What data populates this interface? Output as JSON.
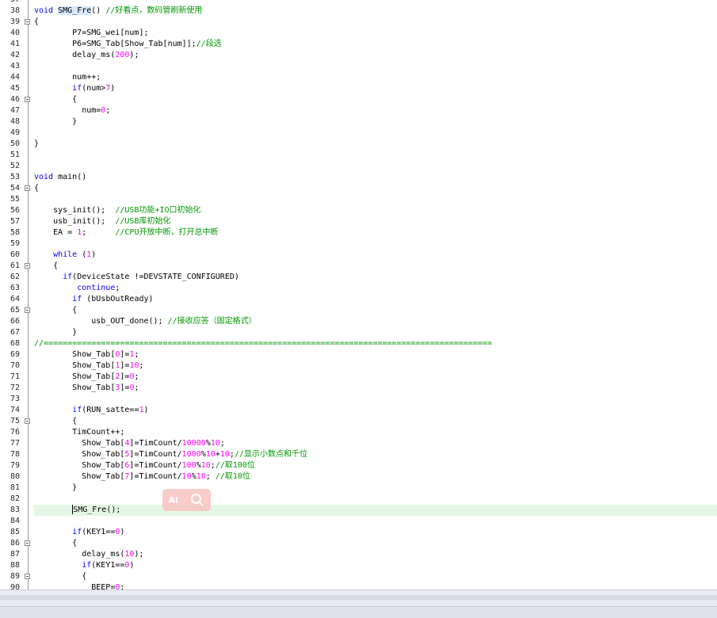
{
  "editor": {
    "lines": [
      {
        "n": "37",
        "fold": false,
        "html": ""
      },
      {
        "n": "38",
        "fold": false,
        "html": "<span class=\"kw\">void</span> <span class=\"hl\">SMG_Fre</span>() <span class=\"cm\">//好看点，数码管刷新使用</span>"
      },
      {
        "n": "39",
        "fold": true,
        "html": "{"
      },
      {
        "n": "40",
        "fold": false,
        "html": "        P7=SMG_wei[num];"
      },
      {
        "n": "41",
        "fold": false,
        "html": "        P6=SMG_Tab[Show_Tab[num]];<span class=\"cm\">//段选</span>"
      },
      {
        "n": "42",
        "fold": false,
        "html": "        delay_ms(<span class=\"num\">200</span>);"
      },
      {
        "n": "43",
        "fold": false,
        "html": ""
      },
      {
        "n": "44",
        "fold": false,
        "html": "        num++;"
      },
      {
        "n": "45",
        "fold": false,
        "html": "        <span class=\"kw\">if</span>(num&gt;<span class=\"num\">7</span>)"
      },
      {
        "n": "46",
        "fold": true,
        "html": "        {"
      },
      {
        "n": "47",
        "fold": false,
        "html": "          num=<span class=\"num\">0</span>;"
      },
      {
        "n": "48",
        "fold": false,
        "html": "        }"
      },
      {
        "n": "49",
        "fold": false,
        "html": ""
      },
      {
        "n": "50",
        "fold": false,
        "html": "}"
      },
      {
        "n": "51",
        "fold": false,
        "html": ""
      },
      {
        "n": "52",
        "fold": false,
        "html": ""
      },
      {
        "n": "53",
        "fold": false,
        "html": "<span class=\"kw\">void</span> main()"
      },
      {
        "n": "54",
        "fold": true,
        "html": "{"
      },
      {
        "n": "55",
        "fold": false,
        "html": ""
      },
      {
        "n": "56",
        "fold": false,
        "html": "    sys_init();  <span class=\"cm\">//USB功能+IO口初始化</span>"
      },
      {
        "n": "57",
        "fold": false,
        "html": "    usb_init();  <span class=\"cm\">//USB库初始化</span>"
      },
      {
        "n": "58",
        "fold": false,
        "html": "    EA = <span class=\"num\">1</span>;      <span class=\"cm\">//CPU开放中断，打开总中断</span>"
      },
      {
        "n": "59",
        "fold": false,
        "html": ""
      },
      {
        "n": "60",
        "fold": false,
        "html": "    <span class=\"kw\">while</span> (<span class=\"num\">1</span>)"
      },
      {
        "n": "61",
        "fold": true,
        "html": "    {"
      },
      {
        "n": "62",
        "fold": false,
        "html": "      <span class=\"kw\">if</span>(DeviceState !=DEVSTATE_CONFIGURED)"
      },
      {
        "n": "63",
        "fold": false,
        "html": "         <span class=\"kw\">continue</span>;"
      },
      {
        "n": "64",
        "fold": false,
        "html": "        <span class=\"kw\">if</span> (bUsbOutReady)"
      },
      {
        "n": "65",
        "fold": true,
        "html": "        {"
      },
      {
        "n": "66",
        "fold": false,
        "html": "            usb_OUT_done(); <span class=\"cm\">//接收应答（固定格式）</span>"
      },
      {
        "n": "67",
        "fold": false,
        "html": "        }"
      },
      {
        "n": "68",
        "fold": false,
        "html": "<span class=\"cm\">//==============================================================================================</span>"
      },
      {
        "n": "69",
        "fold": false,
        "html": "        Show_Tab[<span class=\"num\">0</span>]=<span class=\"num\">1</span>;"
      },
      {
        "n": "70",
        "fold": false,
        "html": "        Show_Tab[<span class=\"num\">1</span>]=<span class=\"num\">10</span>;"
      },
      {
        "n": "71",
        "fold": false,
        "html": "        Show_Tab[<span class=\"num\">2</span>]=<span class=\"num\">0</span>;"
      },
      {
        "n": "72",
        "fold": false,
        "html": "        Show_Tab[<span class=\"num\">3</span>]=<span class=\"num\">0</span>;"
      },
      {
        "n": "73",
        "fold": false,
        "html": ""
      },
      {
        "n": "74",
        "fold": false,
        "html": "        <span class=\"kw\">if</span>(RUN_satte==<span class=\"num\">1</span>)"
      },
      {
        "n": "75",
        "fold": true,
        "html": "        {"
      },
      {
        "n": "76",
        "fold": false,
        "html": "        TimCount++;"
      },
      {
        "n": "77",
        "fold": false,
        "html": "          Show_Tab[<span class=\"num\">4</span>]=TimCount/<span class=\"num\">10000</span>%<span class=\"num\">10</span>;"
      },
      {
        "n": "78",
        "fold": false,
        "html": "          Show_Tab[<span class=\"num\">5</span>]=TimCount/<span class=\"num\">1000</span>%<span class=\"num\">10</span>+<span class=\"num\">10</span>;<span class=\"cm\">//显示小数点和千位</span>"
      },
      {
        "n": "79",
        "fold": false,
        "html": "          Show_Tab[<span class=\"num\">6</span>]=TimCount/<span class=\"num\">100</span>%<span class=\"num\">10</span>;<span class=\"cm\">//取100位</span>"
      },
      {
        "n": "80",
        "fold": false,
        "html": "          Show_Tab[<span class=\"num\">7</span>]=TimCount/<span class=\"num\">10</span>%<span class=\"num\">10</span>; <span class=\"cm\">//取10位</span>"
      },
      {
        "n": "81",
        "fold": false,
        "html": "        }"
      },
      {
        "n": "82",
        "fold": false,
        "html": ""
      },
      {
        "n": "83",
        "fold": false,
        "current": true,
        "html": "        <span class=\"caret\"></span>SMG_Fre();"
      },
      {
        "n": "84",
        "fold": false,
        "html": ""
      },
      {
        "n": "85",
        "fold": false,
        "html": "        <span class=\"kw\">if</span>(KEY1==<span class=\"num\">0</span>)"
      },
      {
        "n": "86",
        "fold": true,
        "html": "        {"
      },
      {
        "n": "87",
        "fold": false,
        "html": "          delay_ms(<span class=\"num\">10</span>);"
      },
      {
        "n": "88",
        "fold": false,
        "html": "          <span class=\"kw\">if</span>(KEY1==<span class=\"num\">0</span>)"
      },
      {
        "n": "89",
        "fold": true,
        "html": "          {"
      },
      {
        "n": "90",
        "fold": false,
        "html": "            BEEP=<span class=\"num\">0</span>;"
      }
    ]
  },
  "overlay": {
    "ai_label": "Ai",
    "search_icon": "magnifier-icon"
  }
}
